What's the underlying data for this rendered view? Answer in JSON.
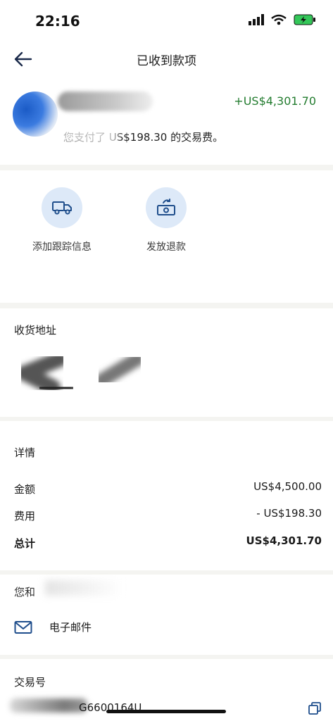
{
  "status_bar": {
    "time": "22:16"
  },
  "header": {
    "title": "已收到款项"
  },
  "payment": {
    "amount": "+US$4,301.70",
    "fee_text": "您支付了 US$198.30 的交易费。"
  },
  "actions": [
    {
      "label": "添加跟踪信息",
      "icon": "truck-icon"
    },
    {
      "label": "发放退款",
      "icon": "refund-money-icon"
    }
  ],
  "address": {
    "heading": "收货地址"
  },
  "details": {
    "heading": "详情",
    "rows": [
      {
        "label": "金额",
        "value": "US$4,500.00"
      },
      {
        "label": "费用",
        "value": "- US$198.30"
      },
      {
        "label": "总计",
        "value": "US$4,301.70"
      }
    ]
  },
  "contact": {
    "heading": "您和",
    "email_label": "电子邮件",
    "email_icon": "envelope-icon"
  },
  "transaction": {
    "heading": "交易号",
    "id_suffix": "G6600164U",
    "copy_icon": "copy-icon"
  },
  "colors": {
    "accent": "#1f4e8c",
    "positive_amount": "#237c2f",
    "icon_bg": "#dde9f8",
    "divider": "#f4f4f1"
  }
}
